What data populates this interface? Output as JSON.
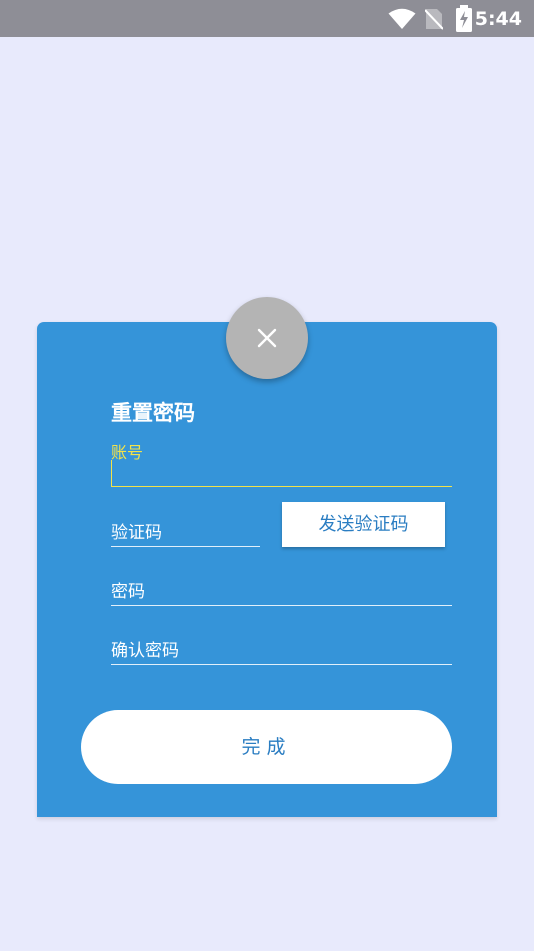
{
  "status_bar": {
    "time": "5:44",
    "icons": [
      "wifi-icon",
      "no-sim-icon",
      "battery-charging-icon"
    ]
  },
  "dialog": {
    "title": "重置密码",
    "close_icon": "close-icon",
    "account": {
      "label": "账号",
      "value": ""
    },
    "verification_code": {
      "placeholder": "验证码",
      "value": ""
    },
    "send_code_label": "发送验证码",
    "password": {
      "placeholder": "密码",
      "value": ""
    },
    "confirm_password": {
      "placeholder": "确认密码",
      "value": ""
    },
    "submit_label": "完成"
  },
  "colors": {
    "background": "#e8eafc",
    "status_bar": "#8e8e96",
    "card": "#3594d9",
    "accent_yellow": "#f2e24a",
    "close_button": "#b4b4b4",
    "button_text": "#2a7dc2"
  }
}
